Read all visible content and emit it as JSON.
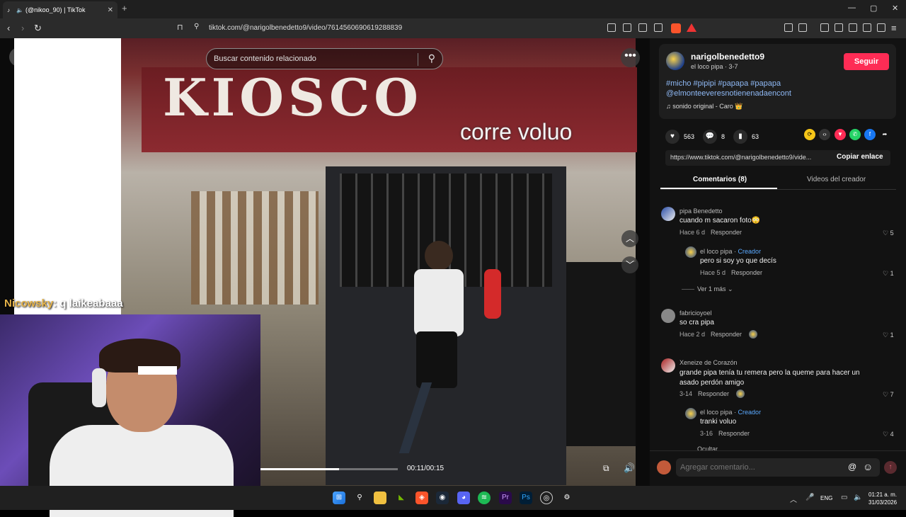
{
  "browser": {
    "tab_title": "(@nikoo_90) | TikTok",
    "new_tab": "+",
    "url": "tiktok.com/@narigolbenedetto9/video/7614560690619288839",
    "window_minimize": "—",
    "window_restore": "▢",
    "window_close": "✕"
  },
  "video": {
    "search_placeholder": "Buscar contenido relacionado",
    "caption": "corre voluo",
    "sign_text": "KIOSCO",
    "time": "00:11/00:15",
    "progress": 0.57
  },
  "stream_overlay": {
    "chat_user": "Nicowsky",
    "chat_message": ": q laikeabaaa"
  },
  "creator": {
    "username": "narigolbenedetto9",
    "subtitle": "el loco pipa · 3-7",
    "follow_label": "Seguir",
    "hashtags": "#micho #pipipi #papapa #papapa @elmonteeveresnotienenadaencont",
    "sound": "sonido original - Caro 👑"
  },
  "stats": {
    "likes": "563",
    "comments": "8",
    "saves": "63"
  },
  "share": {
    "link": "https://www.tiktok.com/@narigolbenedetto9/vide...",
    "copy_label": "Copiar enlace"
  },
  "tabs": {
    "comments": "Comentarios (8)",
    "videos": "Videos del creador"
  },
  "comments": [
    {
      "user": "pipa Benedetto",
      "text": "cuando m sacaron foto😳",
      "meta": "Hace 6 d",
      "reply": "Responder",
      "likes": "5"
    },
    {
      "user": "el loco pipa",
      "creator": "Creador",
      "text": "pero si soy yo que decís",
      "meta": "Hace 5 d",
      "reply": "Responder",
      "likes": "1"
    },
    {
      "more": "Ver 1 más"
    },
    {
      "user": "fabricioyoel",
      "text": "so cra pipa",
      "meta": "Hace 2 d",
      "reply": "Responder",
      "likes": "1"
    },
    {
      "user": "Xeneize de Corazón",
      "text": "grande pipa tenía tu remera pero la queme para hacer un asado perdón amigo",
      "meta": "3-14",
      "reply": "Responder",
      "likes": "7"
    },
    {
      "user": "el loco pipa",
      "creator": "Creador",
      "text": "tranki voluo",
      "meta": "3-16",
      "reply": "Responder",
      "likes": "4"
    },
    {
      "more": "Ocultar"
    }
  ],
  "comment_input": {
    "placeholder": "Agregar comentario..."
  },
  "taskbar": {
    "lang": "ENG",
    "time": "01:21 a. m.",
    "date": "31/03/2026"
  },
  "colors": {
    "accent": "#fe2c55",
    "hashtag": "#8fb9f5",
    "creator_badge": "#5aa9ff"
  }
}
